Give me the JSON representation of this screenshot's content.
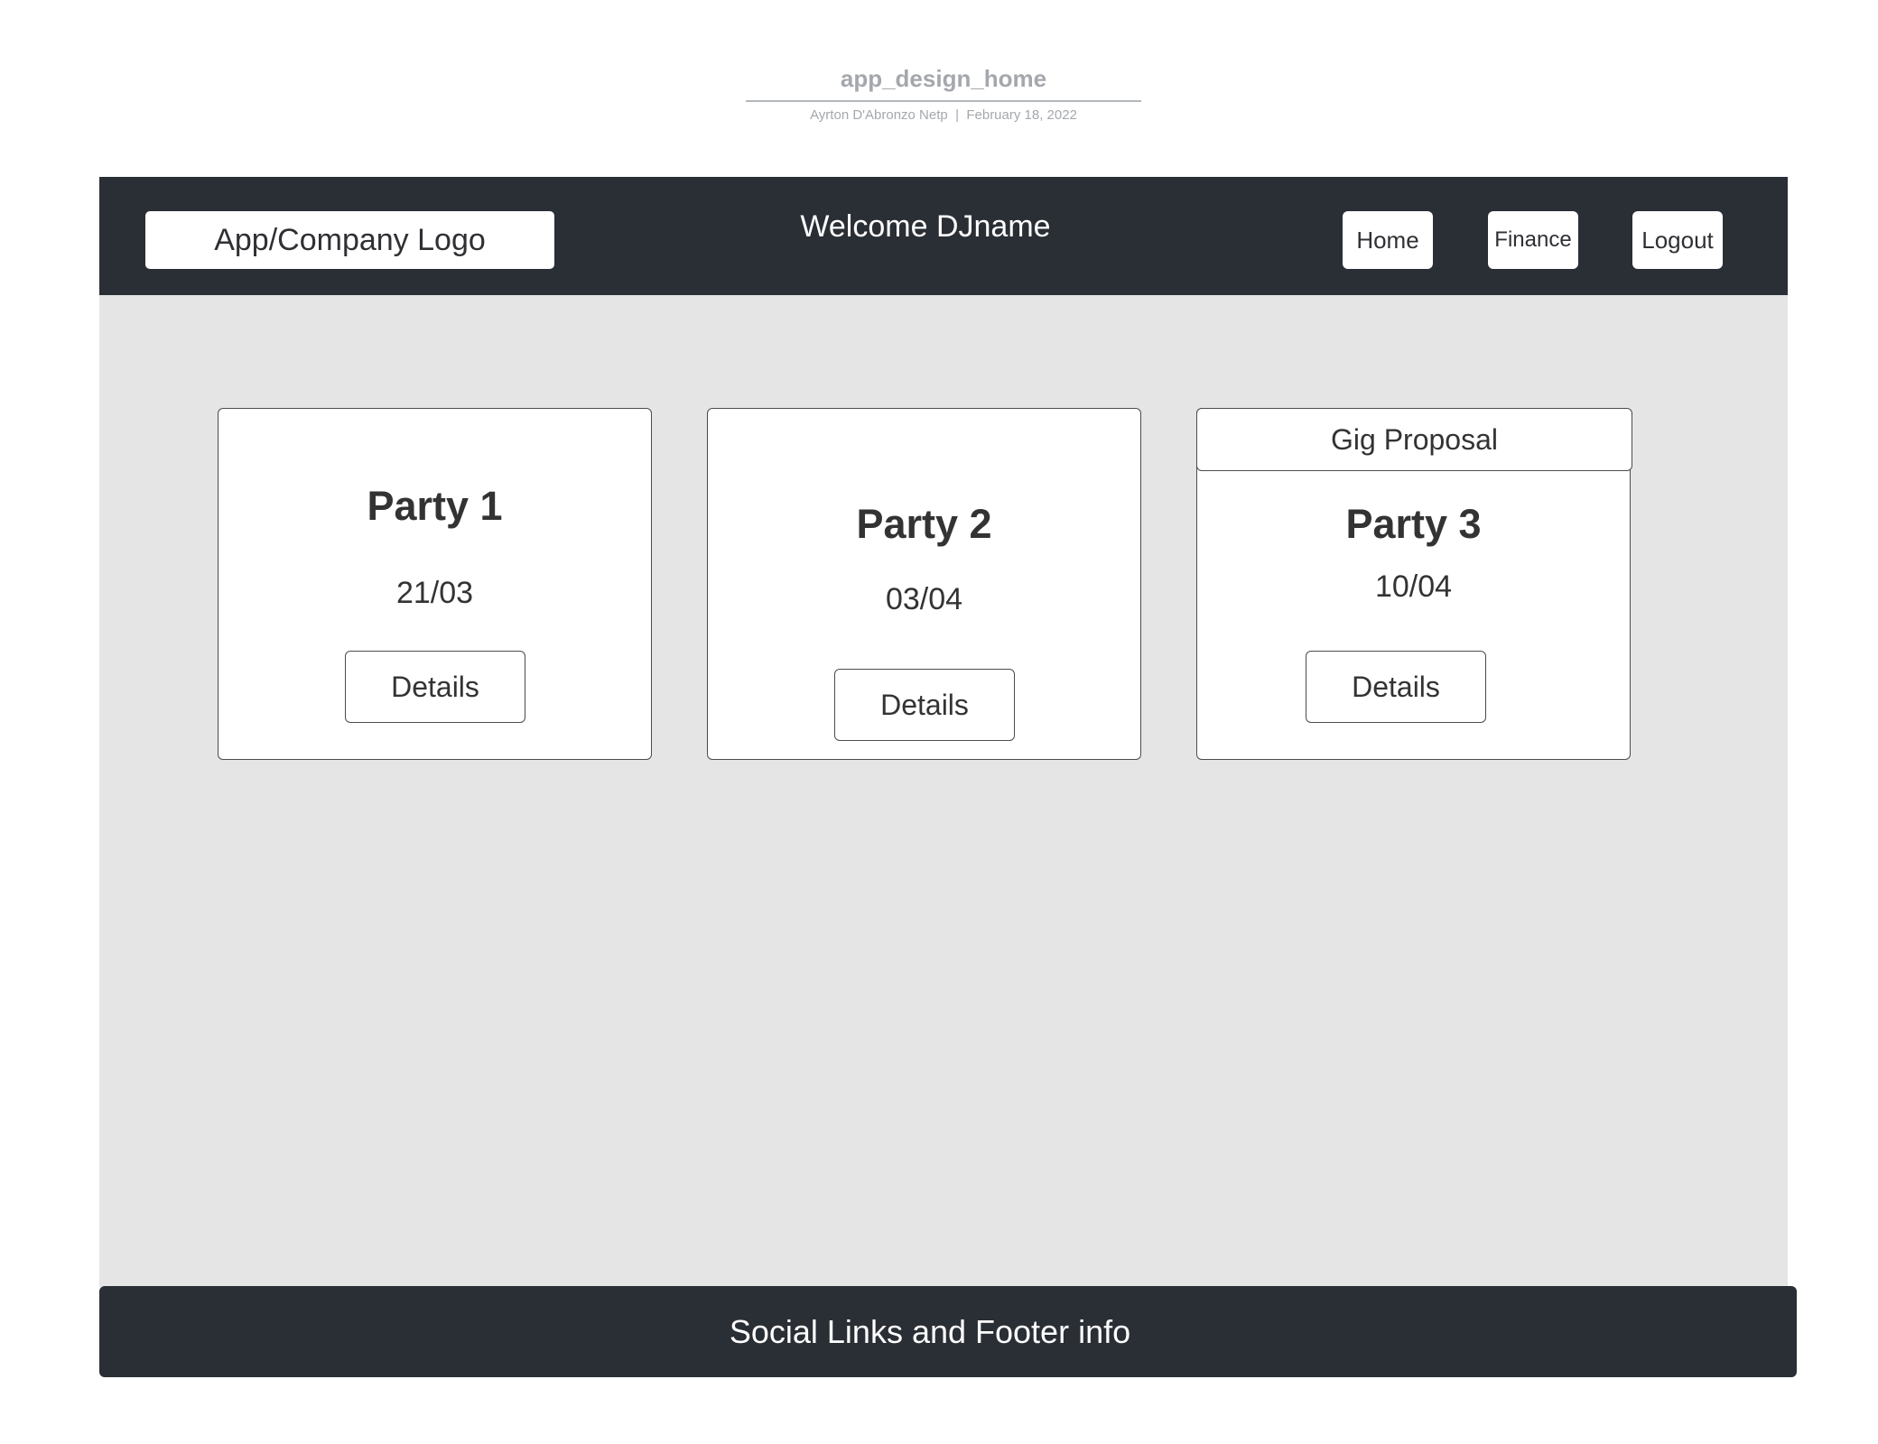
{
  "document": {
    "title": "app_design_home",
    "author": "Ayrton D'Abronzo Netp",
    "separator": "|",
    "date": "February 18, 2022"
  },
  "header": {
    "logo": "App/Company Logo",
    "welcome": "Welcome DJname",
    "nav": {
      "home": "Home",
      "finance": "Finance",
      "logout": "Logout"
    }
  },
  "cards": [
    {
      "title": "Party 1",
      "date": "21/03",
      "button": "Details"
    },
    {
      "title": "Party 2",
      "date": "03/04",
      "button": "Details"
    },
    {
      "title": "Party 3",
      "date": "10/04",
      "button": "Details",
      "proposal": "Gig Proposal"
    }
  ],
  "footer": {
    "text": "Social Links and Footer info"
  },
  "colors": {
    "header_bg": "#2a2e35",
    "content_bg": "#e5e5e5",
    "card_bg": "#ffffff",
    "muted_text": "#a4a8ad"
  }
}
